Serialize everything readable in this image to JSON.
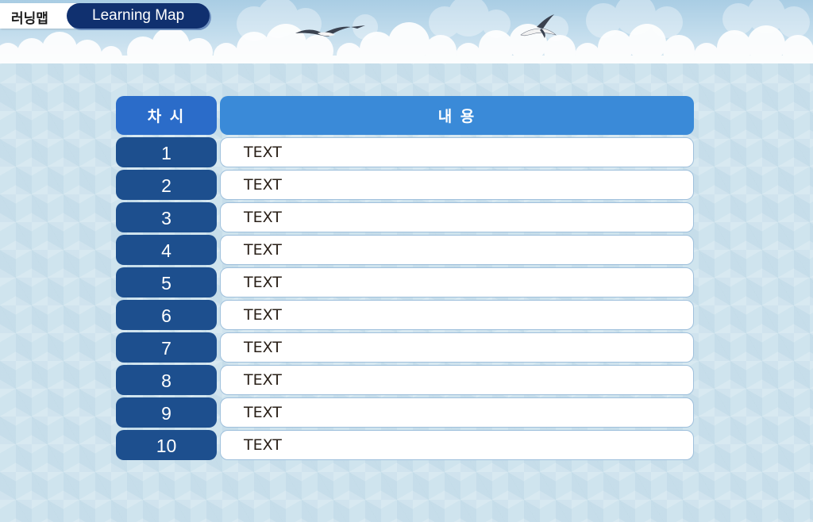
{
  "header": {
    "title_ko": "러닝맵",
    "title_en": "Learning Map"
  },
  "table": {
    "col_number": "차 시",
    "col_content": "내 용",
    "rows": [
      {
        "number": "1",
        "text": "TEXT"
      },
      {
        "number": "2",
        "text": "TEXT"
      },
      {
        "number": "3",
        "text": "TEXT"
      },
      {
        "number": "4",
        "text": "TEXT"
      },
      {
        "number": "5",
        "text": "TEXT"
      },
      {
        "number": "6",
        "text": "TEXT"
      },
      {
        "number": "7",
        "text": "TEXT"
      },
      {
        "number": "8",
        "text": "TEXT"
      },
      {
        "number": "9",
        "text": "TEXT"
      },
      {
        "number": "10",
        "text": "TEXT"
      }
    ]
  },
  "decor": {
    "banner": "sky-with-clouds",
    "birds": [
      "seagull-icon",
      "seagull-icon"
    ]
  },
  "colors": {
    "title_en_bg": "#10306f",
    "head_number_bg": "#2b6cc9",
    "head_content_bg": "#3a8ad8",
    "row_number_bg": "#1d4f8e",
    "page_bg": "#cfe4ee"
  }
}
